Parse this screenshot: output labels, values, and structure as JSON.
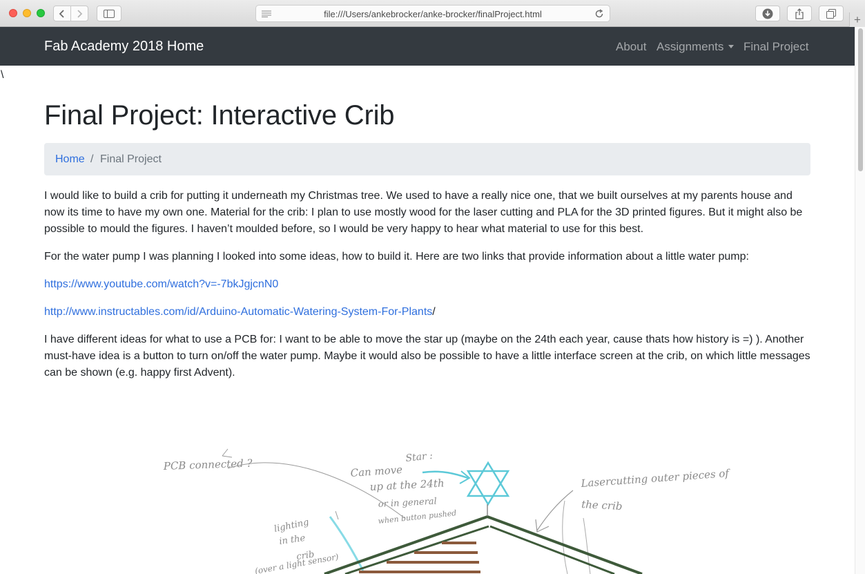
{
  "browser": {
    "url": "file:///Users/ankebrocker/anke-brocker/finalProject.html",
    "new_tab_label": "+"
  },
  "navbar": {
    "brand": "Fab Academy 2018 Home",
    "links": [
      {
        "label": "About"
      },
      {
        "label": "Assignments",
        "dropdown": true
      },
      {
        "label": "Final Project"
      }
    ]
  },
  "page": {
    "stray_char": "\\",
    "title": "Final Project: Interactive Crib",
    "breadcrumb": {
      "home": "Home",
      "separator": "/",
      "current": "Final Project"
    },
    "paragraphs": {
      "intro": "I would like to build a crib for putting it underneath my Christmas tree. We used to have a really nice one, that we built ourselves at my parents house and now its time to have my own one. Material for the crib: I plan to use mostly wood for the laser cutting and PLA for the 3D printed figures. But it might also be possible to mould the figures. I haven’t moulded before, so I would be very happy to hear what material to use for this best.",
      "pump": "For the water pump I was planning I looked into some ideas, how to build it. Here are two links that provide information about a little water pump:",
      "link1": "https://www.youtube.com/watch?v=-7bkJgjcnN0",
      "link2": "http://www.instructables.com/id/Arduino-Automatic-Watering-System-For-Plants",
      "link2_suffix": "/",
      "pcb": "I have different ideas for what to use a PCB for: I want to be able to move the star up (maybe on the 24th each year, cause thats how history is =) ). Another must-have idea is a button to turn on/off the water pump. Maybe it would also be possible to have a little interface screen at the crib, on which little messages can be shown (e.g. happy first Advent)."
    }
  },
  "sketch": {
    "notes": {
      "pcb": "PCB connected ?",
      "star": "Star :",
      "move1": "Can move",
      "move2": "up at the 24th",
      "move3": "or in general",
      "move4": "when button pushed",
      "laser1": "Lasercutting outer pieces of",
      "laser2": "the crib",
      "light1": "lighting",
      "light2": "in the",
      "light3": "crib",
      "light4": "(over a light sensor)"
    },
    "colors": {
      "pencil": "#8a8a8a",
      "star": "#5cc9d8",
      "roof": "#3e5a3a",
      "wood": "#8b5a3c",
      "light": "#88dbe6"
    }
  }
}
